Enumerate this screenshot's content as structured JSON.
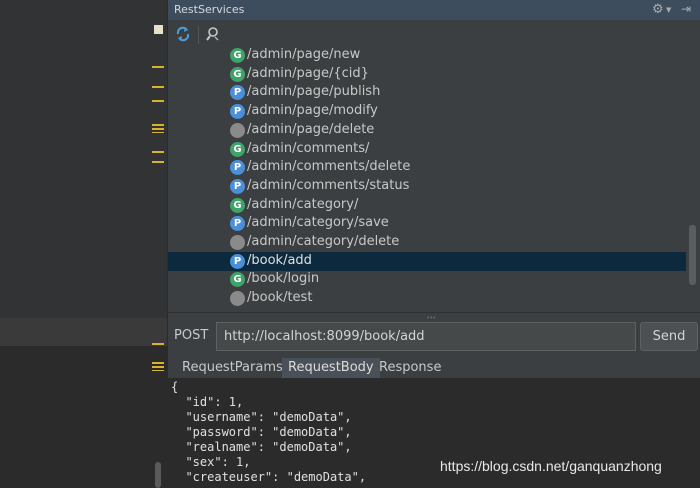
{
  "panel": {
    "title": "RestServices"
  },
  "icons": {
    "gear": "gear-icon",
    "pin": "pin-icon",
    "refresh": "refresh-icon",
    "search": "search-icon"
  },
  "colors": {
    "get_badge": "#3fa36a",
    "post_badge": "#4a8fd8",
    "other_badge": "#8a8a8a",
    "selection": "#0d293e",
    "title_bar": "#3d4d5e"
  },
  "tree": {
    "items": [
      {
        "badge": "G",
        "path": "/admin/page/new"
      },
      {
        "badge": "G",
        "path": "/admin/page/{cid}"
      },
      {
        "badge": "P",
        "path": "/admin/page/publish"
      },
      {
        "badge": "P",
        "path": "/admin/page/modify"
      },
      {
        "badge": "",
        "path": "/admin/page/delete"
      },
      {
        "badge": "G",
        "path": "/admin/comments/"
      },
      {
        "badge": "P",
        "path": "/admin/comments/delete"
      },
      {
        "badge": "P",
        "path": "/admin/comments/status"
      },
      {
        "badge": "G",
        "path": "/admin/category/"
      },
      {
        "badge": "P",
        "path": "/admin/category/save"
      },
      {
        "badge": "",
        "path": "/admin/category/delete"
      },
      {
        "badge": "P",
        "path": "/book/add"
      },
      {
        "badge": "G",
        "path": "/book/login"
      },
      {
        "badge": "",
        "path": "/book/test"
      }
    ],
    "selected_path": "/book/add"
  },
  "request": {
    "method": "POST",
    "url": "http://localhost:8099/book/add",
    "send_label": "Send"
  },
  "tabs": [
    {
      "label": "RequestParams",
      "active": false
    },
    {
      "label": "RequestBody",
      "active": true
    },
    {
      "label": "Response",
      "active": false
    }
  ],
  "body_lines": [
    "{",
    "  \"id\": 1,",
    "  \"username\": \"demoData\",",
    "  \"password\": \"demoData\",",
    "  \"realname\": \"demoData\",",
    "  \"sex\": 1,",
    "  \"createuser\": \"demoData\","
  ],
  "watermark": "https://blog.csdn.net/ganquanzhong"
}
